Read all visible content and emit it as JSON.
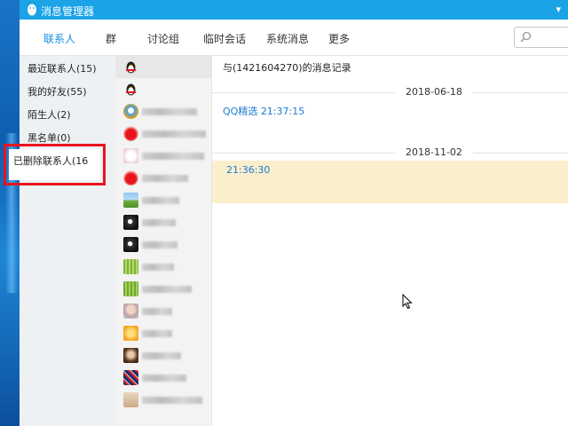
{
  "window": {
    "title": "消息管理器"
  },
  "tabs": [
    {
      "label": "联系人",
      "active": true
    },
    {
      "label": "群"
    },
    {
      "label": "讨论组"
    },
    {
      "label": "临时会话"
    },
    {
      "label": "系统消息"
    },
    {
      "label": "更多"
    }
  ],
  "sidebar": {
    "items": [
      {
        "label": "最近联系人(15)"
      },
      {
        "label": "我的好友(55)"
      },
      {
        "label": "陌生人(2)"
      },
      {
        "label": "黑名单(0)"
      },
      {
        "label": "已删除联系人(16"
      }
    ]
  },
  "history": {
    "title": "与(1421604270)的消息记录",
    "groups": [
      {
        "date": "2018-06-18",
        "sender": "QQ精选 21:37:15"
      },
      {
        "date": "2018-11-02",
        "sender": "21:36:30"
      }
    ]
  },
  "colors": {
    "titlebar": "#1aa3e6",
    "accent": "#1a8ee0",
    "highlight": "#fbeecc",
    "annotation": "#e8141c"
  }
}
